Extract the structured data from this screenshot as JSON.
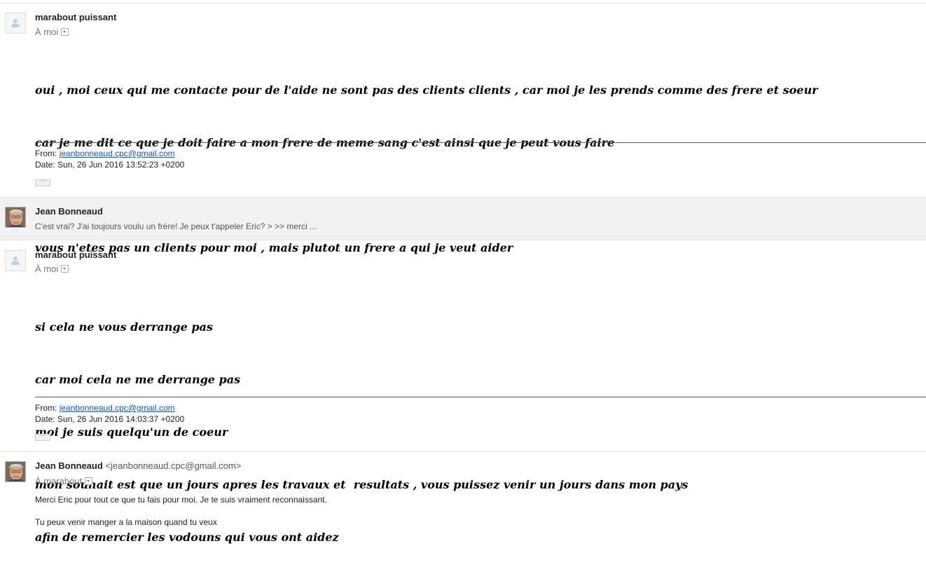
{
  "messages": [
    {
      "sender": "marabout puissant",
      "recipient": "À moi",
      "body": [
        "oui , moi ceux qui me contacte pour de l'aide ne sont pas des clients clients , car moi je les prends comme des frere et soeur",
        "car je me dit ce que je doit faire a mon frere de meme sang c'est ainsi que je peut vous faire",
        "",
        "vous n'etes pas un clients pour moi , mais plutot un frere a qui je veut aider"
      ],
      "from_label": "From:",
      "from_email": "jeanbonneaud.cpc@gmail.com",
      "date_label": "Date:",
      "date": "Sun, 26 Jun 2016 13:52:23 +0200",
      "ellipsis": "···"
    },
    {
      "sender": "Jean Bonneaud",
      "snippet": "C'est vrai? J'ai toujours voulu un frère! Je peux t'appeler Eric? > >> merci ..."
    },
    {
      "sender": "marabout puissant",
      "recipient": "À moi",
      "body": [
        "si cela ne vous derrange pas",
        "car moi cela ne me derrange pas",
        "moi je suis quelqu'un de coeur",
        "mon souhait est que un jours apres les travaux et  resultats , vous puissez venir un jours dans mon pays",
        "afin de remercier les vodouns qui vous ont aidez"
      ],
      "from_label": "From:",
      "from_email": "jeanbonneaud.cpc@gmail.com",
      "date_label": "Date:",
      "date": "Sun, 26 Jun 2016 14:03:37 +0200",
      "ellipsis": "···"
    },
    {
      "sender": "Jean Bonneaud",
      "sender_email": "<jeanbonneaud.cpc@gmail.com>",
      "recipient": "À marabout",
      "body": [
        "Merci Eric pour tout ce que tu fais pour moi. Je te suis vraiment reconnaissant.",
        "Tu peux venir manger a la maison quand tu veux"
      ]
    }
  ]
}
